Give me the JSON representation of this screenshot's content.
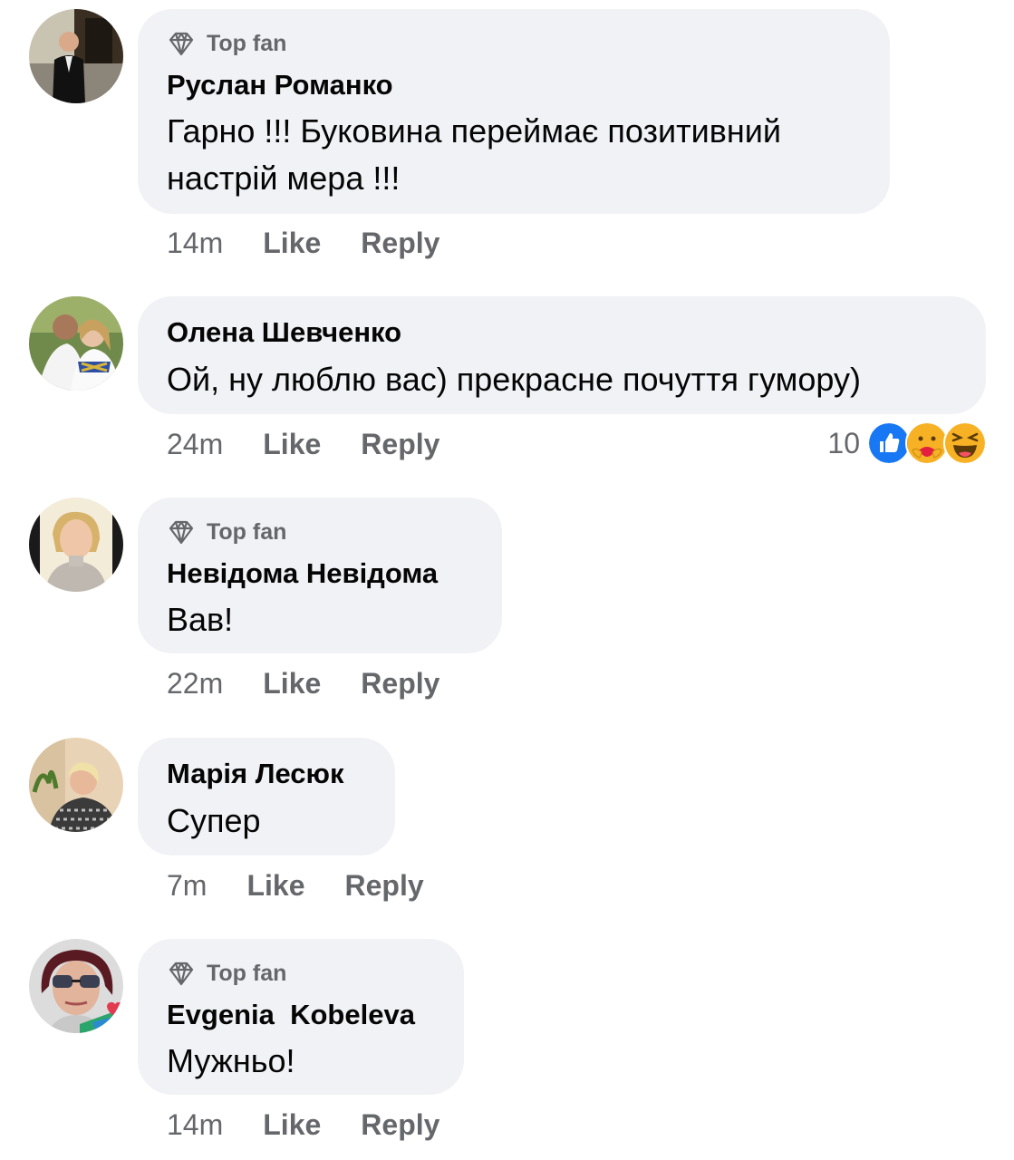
{
  "comments": [
    {
      "badge": "Top fan",
      "name": "Руслан Романко",
      "lines": [
        "Гарно !!! Буковина переймає позитивний",
        "настрій мера !!!"
      ],
      "time": "14m",
      "like": "Like",
      "reply": "Reply"
    },
    {
      "name": "Олена Шевченко",
      "lines": [
        "Ой, ну люблю вас) прекрасне почуття гумору)"
      ],
      "time": "24m",
      "like": "Like",
      "reply": "Reply",
      "reaction_count": "10",
      "reactions": [
        "like-reaction-icon",
        "care-reaction-icon",
        "haha-reaction-icon"
      ]
    },
    {
      "badge": "Top fan",
      "name": "Невідома Невідома",
      "lines": [
        "Вав!"
      ],
      "time": "22m",
      "like": "Like",
      "reply": "Reply"
    },
    {
      "name": "Марія Лесюк",
      "lines": [
        "Супер"
      ],
      "time": "7m",
      "like": "Like",
      "reply": "Reply"
    },
    {
      "badge": "Top fan",
      "name": "Evgenia  Kobeleva",
      "lines": [
        "Мужньо!"
      ],
      "time": "14m",
      "like": "Like",
      "reply": "Reply"
    }
  ],
  "colors": {
    "bubble": "#f0f2f5",
    "meta": "#65676b",
    "text": "#050505",
    "like_blue": "#1877f2"
  }
}
